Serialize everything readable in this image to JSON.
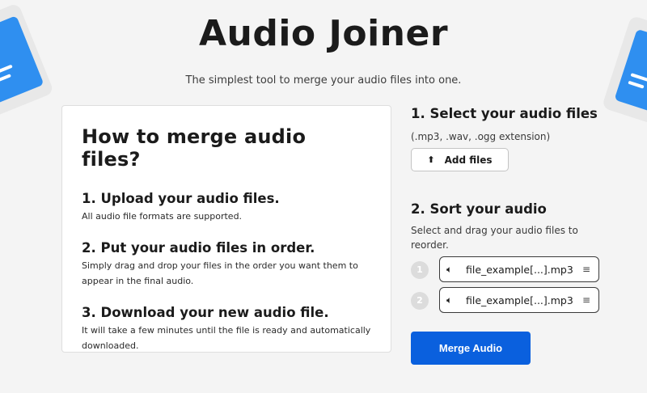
{
  "page": {
    "title": "Audio Joiner",
    "subtitle": "The simplest tool to merge your audio files into one."
  },
  "guide": {
    "heading": "How to merge audio files?",
    "steps": [
      {
        "title": "1. Upload your audio files.",
        "text": "All audio file formats are supported."
      },
      {
        "title": "2. Put your audio files in order.",
        "text": "Simply drag and drop your files in the order you want them to appear in the final audio."
      },
      {
        "title": "3. Download your new audio file.",
        "text": "It will take a few minutes until the file is ready and automatically downloaded."
      }
    ]
  },
  "select": {
    "title": "1.  Select your audio files",
    "extensions": "(.mp3, .wav, .ogg extension)",
    "add_label": "Add files",
    "add_icon": "upload-icon"
  },
  "sort": {
    "title": "2. Sort your audio",
    "hint": "Select and drag your audio files to reorder.",
    "files": [
      {
        "num": "1",
        "name": "file_example[...].mp3"
      },
      {
        "num": "2",
        "name": "file_example[...].mp3"
      }
    ]
  },
  "merge": {
    "label": "Merge Audio"
  },
  "colors": {
    "accent": "#0a60de",
    "background": "#f4f4f4",
    "deco_blue": "#2f8ff0"
  }
}
